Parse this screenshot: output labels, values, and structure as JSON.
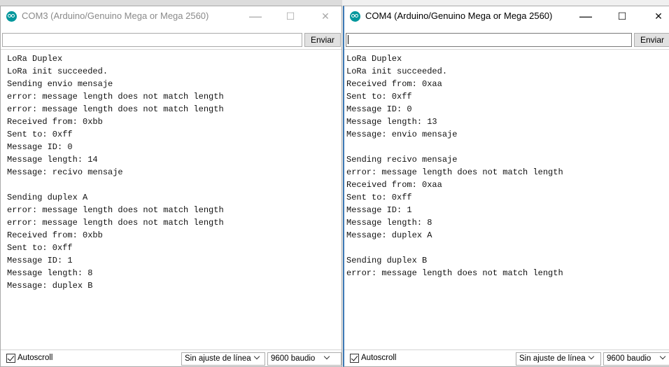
{
  "left_window": {
    "title": "COM3 (Arduino/Genuino Mega or Mega 2560)",
    "controls": {
      "minimize": "—",
      "maximize": "☐",
      "close": "✕"
    },
    "send_input": {
      "value": "",
      "placeholder": ""
    },
    "send_label": "Enviar",
    "log": [
      "LoRa Duplex",
      "LoRa init succeeded.",
      "Sending envio mensaje",
      "error: message length does not match length",
      "error: message length does not match length",
      "Received from: 0xbb",
      "Sent to: 0xff",
      "Message ID: 0",
      "Message length: 14",
      "Message: recivo mensaje",
      "",
      "Sending duplex A",
      "error: message length does not match length",
      "error: message length does not match length",
      "Received from: 0xbb",
      "Sent to: 0xff",
      "Message ID: 1",
      "Message length: 8",
      "Message: duplex B"
    ],
    "autoscroll_label": "Autoscroll",
    "autoscroll_checked": true,
    "line_ending": "Sin ajuste de línea",
    "baud_rate": "9600 baudio"
  },
  "right_window": {
    "title": "COM4 (Arduino/Genuino Mega or Mega 2560)",
    "controls": {
      "minimize": "—",
      "maximize": "☐",
      "close": "✕"
    },
    "send_input": {
      "value": "",
      "placeholder": ""
    },
    "send_label": "Enviar",
    "log": [
      "LoRa Duplex",
      "LoRa init succeeded.",
      "Received from: 0xaa",
      "Sent to: 0xff",
      "Message ID: 0",
      "Message length: 13",
      "Message: envio mensaje",
      "",
      "Sending recivo mensaje",
      "error: message length does not match length",
      "Received from: 0xaa",
      "Sent to: 0xff",
      "Message ID: 1",
      "Message length: 8",
      "Message: duplex A",
      "",
      "Sending duplex B",
      "error: message length does not match length"
    ],
    "autoscroll_label": "Autoscroll",
    "autoscroll_checked": true,
    "line_ending": "Sin ajuste de línea",
    "baud_rate": "9600 baudio"
  },
  "icons": {
    "app": "arduino-logo-icon",
    "dropdown": "chevron-down-icon",
    "check": "check-icon"
  },
  "colors": {
    "arduino_teal": "#00979c",
    "active_border": "#3c78b4"
  }
}
